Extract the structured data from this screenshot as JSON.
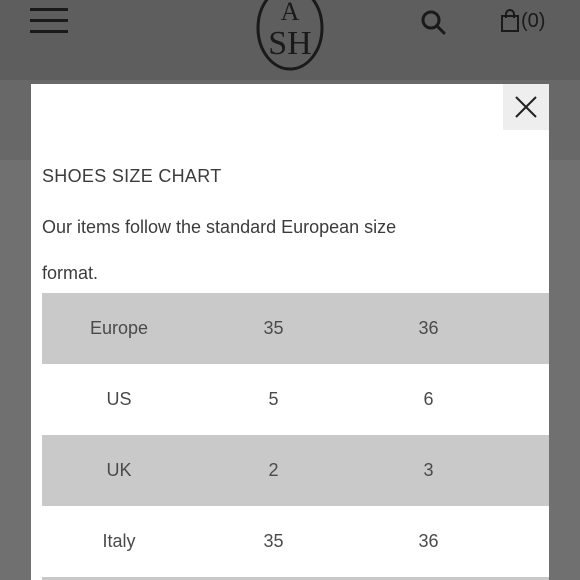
{
  "header": {
    "logo": {
      "letters_top": "A",
      "letters_bottom": "SH"
    },
    "cart_count": "(0)"
  },
  "modal": {
    "title": "SHOES SIZE CHART",
    "description": "Our items follow the standard European size format.",
    "rows": [
      {
        "label": "Europe",
        "values": [
          "35",
          "36"
        ]
      },
      {
        "label": "US",
        "values": [
          "5",
          "6"
        ]
      },
      {
        "label": "UK",
        "values": [
          "2",
          "3"
        ]
      },
      {
        "label": "Italy",
        "values": [
          "35",
          "36"
        ]
      }
    ]
  },
  "colors": {
    "overlay": "#6b6b6b",
    "row_shade": "#c9c9c9",
    "text": "#3c3c3c"
  }
}
